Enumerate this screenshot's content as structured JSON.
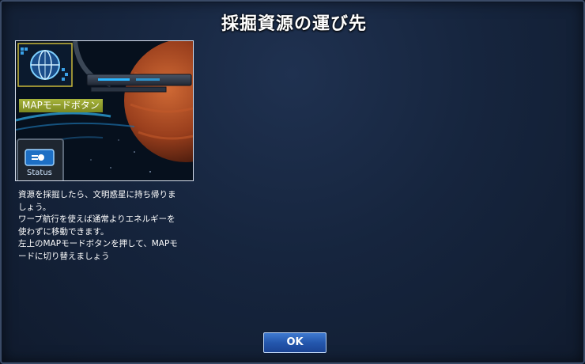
{
  "dialog": {
    "title": "採掘資源の運び先",
    "preview": {
      "callout_label": "MAPモードボタン",
      "status_label": "Status"
    },
    "description": [
      "資源を採掘したら、文明惑星に持ち帰りま",
      "しょう。",
      "ワープ航行を使えば通常よりエネルギーを",
      "使わずに移動できます。",
      "左上のMAPモードボタンを押して、MAPモ",
      "ードに切り替えましょう"
    ],
    "ok_label": "OK"
  },
  "colors": {
    "background": "#16253e",
    "border": "#3a4a66",
    "callout": "#97a32f",
    "button": "#2457ad"
  },
  "icons": [
    "map-mode-globe-icon",
    "status-icon"
  ]
}
